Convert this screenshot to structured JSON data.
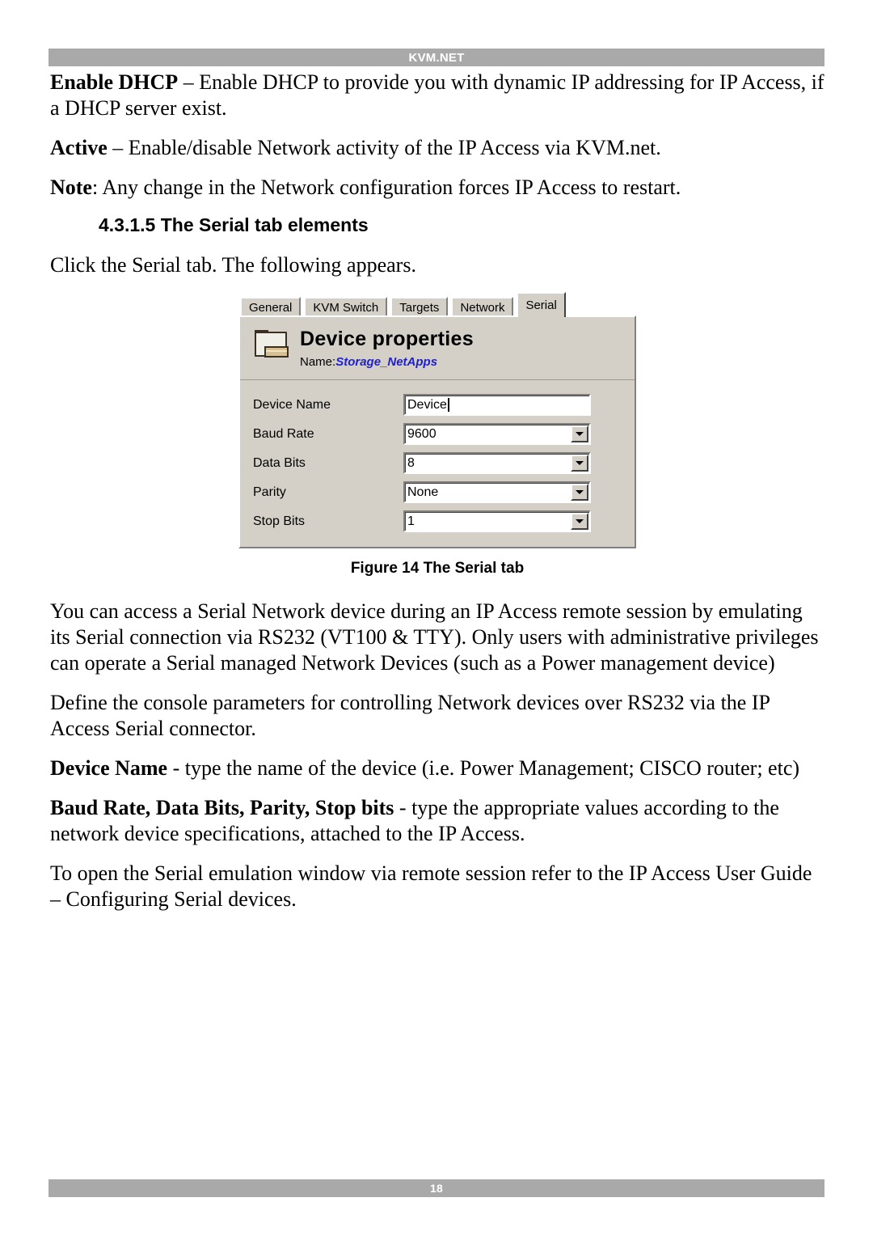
{
  "header": {
    "title": "KVM.NET"
  },
  "footer": {
    "page_number": "18"
  },
  "body": {
    "para_dhcp_lead": "Enable DHCP",
    "para_dhcp_rest": " – Enable DHCP to provide you with dynamic IP addressing for IP Access, if a DHCP server exist.",
    "para_active_lead": "Active",
    "para_active_rest": " – Enable/disable Network activity of the IP Access via KVM.net.",
    "para_note_lead": "Note",
    "para_note_rest": ": Any change in the Network configuration forces IP Access to restart.",
    "section_heading": "4.3.1.5 The Serial tab elements",
    "para_click": "Click the Serial tab. The following appears.",
    "para_access": "You can access a Serial Network device during an IP Access remote session by emulating its Serial connection via RS232 (VT100 & TTY). Only users with administrative privileges can operate a Serial managed Network Devices (such as a Power management device)",
    "para_define": "Define the console parameters for controlling Network devices over RS232 via the IP Access Serial connector.",
    "para_devname_lead": "Device Name",
    "para_devname_rest": " - type the name of the device (i.e. Power Management; CISCO router; etc)",
    "para_baud_lead": "Baud Rate, Data Bits, Parity, Stop bits",
    "para_baud_rest": " - type the appropriate values according to the network device specifications, attached to the IP Access.",
    "para_open": "To open the Serial emulation window via remote session refer to the IP Access User Guide – Configuring Serial devices."
  },
  "figure": {
    "caption": "Figure 14 The Serial tab",
    "dialog": {
      "tabs": [
        {
          "label": "General",
          "active": false
        },
        {
          "label": "KVM Switch",
          "active": false
        },
        {
          "label": "Targets",
          "active": false
        },
        {
          "label": "Network",
          "active": false
        },
        {
          "label": "Serial",
          "active": true
        }
      ],
      "panel_title": "Device properties",
      "name_label": "Name:",
      "name_value": "Storage_NetApps",
      "fields": [
        {
          "label": "Device Name",
          "value": "Device",
          "type": "textbox"
        },
        {
          "label": "Baud Rate",
          "value": "9600",
          "type": "combobox"
        },
        {
          "label": "Data Bits",
          "value": "8",
          "type": "combobox"
        },
        {
          "label": "Parity",
          "value": "None",
          "type": "combobox"
        },
        {
          "label": "Stop Bits",
          "value": "1",
          "type": "combobox"
        }
      ]
    }
  },
  "colors": {
    "bar_gray": "#a9a9a9",
    "dialog_face": "#d4d0c8",
    "name_blue": "#2020cc",
    "folder_drawer": "#d8bf8f"
  }
}
